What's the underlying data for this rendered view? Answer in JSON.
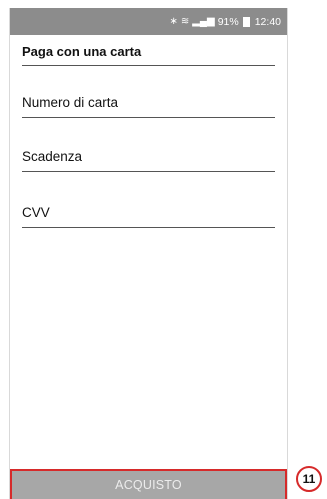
{
  "statusbar": {
    "icons": [
      "bluetooth-icon",
      "wifi-icon",
      "signal-icon"
    ],
    "bluetooth": "∗",
    "wifi": "≋",
    "signal": "▂▄▆",
    "battery_percent": "91%",
    "time": "12:40"
  },
  "header": {
    "title": "Paga con una carta"
  },
  "form": {
    "card_number_label": "Numero di carta",
    "expiry_label": "Scadenza",
    "cvv_label": "CVV"
  },
  "actions": {
    "buy_label": "ACQUISTO"
  },
  "annotation": {
    "step_number": "11"
  },
  "colors": {
    "status_bar": "#8c8c8c",
    "button_bg": "#a7a7a7",
    "highlight": "#d62a2a"
  }
}
